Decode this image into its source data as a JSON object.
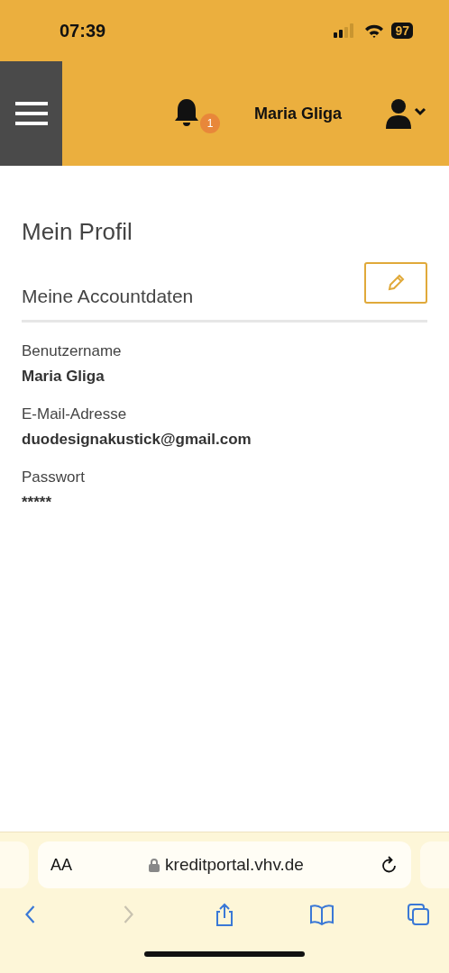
{
  "status_bar": {
    "time": "07:39",
    "battery": "97"
  },
  "header": {
    "notification_count": "1",
    "user_name": "Maria Gliga"
  },
  "page": {
    "title": "Mein Profil",
    "section_title": "Meine Accountdaten",
    "fields": [
      {
        "label": "Benutzername",
        "value": "Maria Gliga"
      },
      {
        "label": "E-Mail-Adresse",
        "value": "duodesignakustick@gmail.com"
      },
      {
        "label": "Passwort",
        "value": "*****"
      }
    ]
  },
  "browser": {
    "text_size": "AA",
    "url": "kreditportal.vhv.de",
    "toolbar": [
      {
        "kind": "back",
        "disabled": false
      },
      {
        "kind": "forward",
        "disabled": true
      },
      {
        "kind": "share",
        "disabled": false
      },
      {
        "kind": "bookmarks",
        "disabled": false
      },
      {
        "kind": "tabs",
        "disabled": false
      }
    ]
  }
}
